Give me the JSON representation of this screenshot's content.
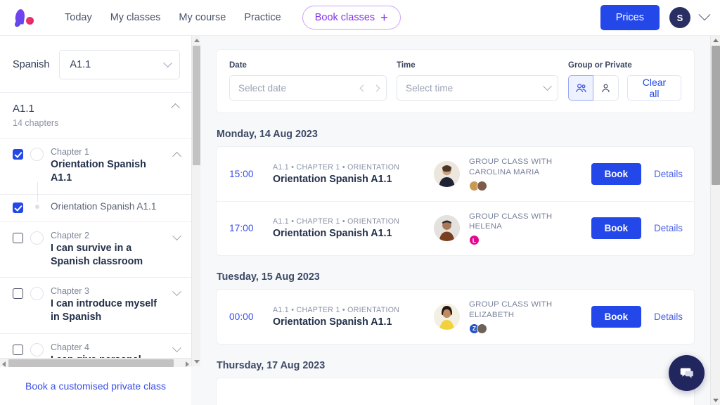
{
  "header": {
    "logo_icon": "brand-comma-logo",
    "nav": [
      {
        "label": "Today"
      },
      {
        "label": "My classes"
      },
      {
        "label": "My course"
      },
      {
        "label": "Practice"
      }
    ],
    "book_classes": {
      "label": "Book classes",
      "plus": "+"
    },
    "prices_label": "Prices",
    "avatar_initial": "S",
    "accent_blue": "#2347e8",
    "accent_purple": "#8335e8"
  },
  "sidebar": {
    "course_label": "Spanish",
    "level_selected": "A1.1",
    "level_panel": {
      "title": "A1.1",
      "subtitle": "14 chapters"
    },
    "chapters": [
      {
        "number": "Chapter 1",
        "title": "Orientation Spanish A1.1",
        "checked": true,
        "expanded": true,
        "lessons": [
          {
            "label": "Orientation Spanish A1.1",
            "checked": true
          }
        ]
      },
      {
        "number": "Chapter 2",
        "title": "I can survive in a Spanish classroom",
        "checked": false,
        "expanded": false,
        "lessons": []
      },
      {
        "number": "Chapter 3",
        "title": "I can introduce myself in Spanish",
        "checked": false,
        "expanded": false,
        "lessons": []
      },
      {
        "number": "Chapter 4",
        "title": "I can give personal details in Spanish",
        "checked": false,
        "expanded": false,
        "lessons": []
      }
    ],
    "footer_link": "Book a customised private class"
  },
  "filters": {
    "date": {
      "label": "Date",
      "placeholder": "Select date",
      "value": ""
    },
    "time": {
      "label": "Time",
      "placeholder": "Select time",
      "value": ""
    },
    "group_or_private": {
      "label": "Group or Private",
      "options": [
        {
          "name": "group",
          "icon": "group-people-icon",
          "selected": true
        },
        {
          "name": "private",
          "icon": "single-person-icon",
          "selected": false
        }
      ]
    },
    "clear_all": "Clear all"
  },
  "schedule": [
    {
      "day": "Monday, 14 Aug 2023",
      "classes": [
        {
          "time": "15:00",
          "breadcrumb": "A1.1 • CHAPTER 1 • ORIENTATION",
          "title": "Orientation Spanish A1.1",
          "with": "GROUP CLASS WITH CAROLINA MARIA",
          "participants": [
            {
              "initial": "",
              "color": "#c69a52"
            },
            {
              "initial": "",
              "color": "#7d5a4a"
            }
          ],
          "book_label": "Book",
          "details_label": "Details"
        },
        {
          "time": "17:00",
          "breadcrumb": "A1.1 • CHAPTER 1 • ORIENTATION",
          "title": "Orientation Spanish A1.1",
          "with": "GROUP CLASS WITH HELENA",
          "participants": [
            {
              "initial": "L",
              "color": "#e5068f"
            }
          ],
          "book_label": "Book",
          "details_label": "Details"
        }
      ]
    },
    {
      "day": "Tuesday, 15 Aug 2023",
      "classes": [
        {
          "time": "00:00",
          "breadcrumb": "A1.1 • CHAPTER 1 • ORIENTATION",
          "title": "Orientation Spanish A1.1",
          "with": "GROUP CLASS WITH ELIZABETH",
          "participants": [
            {
              "initial": "Z",
              "color": "#2450c8"
            },
            {
              "initial": "",
              "color": "#6d6257"
            }
          ],
          "book_label": "Book",
          "details_label": "Details"
        }
      ]
    },
    {
      "day": "Thursday, 17 Aug 2023",
      "classes": []
    }
  ],
  "chat_button": {
    "icon": "chat-bubble-icon"
  }
}
